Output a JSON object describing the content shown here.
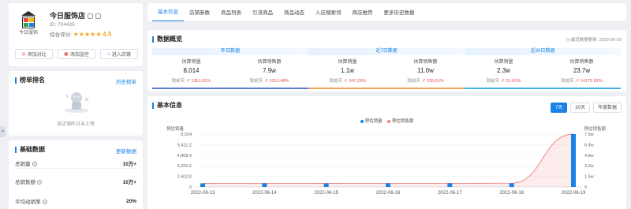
{
  "shop": {
    "name": "今日服饰店",
    "logo_text": "今日服饰",
    "id_label": "ID: 704425",
    "rating_label": "综合评分:",
    "stars": "★★★★★",
    "rating": "4.5"
  },
  "shop_buttons": [
    {
      "label": "添加对比",
      "icon": "target-icon"
    },
    {
      "label": "添加监控",
      "icon": "monitor-icon"
    },
    {
      "label": "进入店铺",
      "icon": "store-icon"
    }
  ],
  "ranking": {
    "title": "榜单排名",
    "link": "历史榜单",
    "empty_text": "该店铺昨日未上榜"
  },
  "base_data": {
    "title": "基础数据",
    "link": "更新数据",
    "rows": [
      {
        "label": "总销量",
        "value": "10万+"
      },
      {
        "label": "总销售额",
        "value": "10万+"
      },
      {
        "label": "平均动销率",
        "value": "20%"
      }
    ]
  },
  "tabs": [
    "基本信息",
    "店铺参数",
    "商品列表",
    "引流商品",
    "商品动态",
    "入店搜索词",
    "商店推荐",
    "更多历史数据"
  ],
  "overview": {
    "title": "数据概览",
    "update": "最近数据更新: 2022-06-20",
    "periods": [
      {
        "title": "昨日数据",
        "sales_label": "估算销量",
        "sales": "8,014",
        "sales_chg_label": "较前天",
        "sales_chg": "1351.81%",
        "amount_label": "估算销售额",
        "amount": "7.9w",
        "amount_chg_label": "较前天",
        "amount_chg": "1313.48%"
      },
      {
        "title": "近7日数据",
        "sales_label": "估算销量",
        "sales": "1.1w",
        "sales_chg_label": "较前天",
        "sales_chg": "247.29%",
        "amount_label": "估算销售额",
        "amount": "11.0w",
        "amount_chg_label": "较前天",
        "amount_chg": "239.61%"
      },
      {
        "title": "近30日数据",
        "sales_label": "估算销量",
        "sales": "2.3w",
        "sales_chg_label": "较前天",
        "sales_chg": "51.62%",
        "amount_label": "估算销售额",
        "amount": "23.7w",
        "amount_chg_label": "较前天",
        "amount_chg": "14175.82%"
      }
    ]
  },
  "basic_info": {
    "title": "基本信息",
    "ranges": [
      "7天",
      "30天",
      "年度数据"
    ],
    "active_range": "7天"
  },
  "chart_data": {
    "type": "bar",
    "categories": [
      "2022-06-13",
      "2022-06-14",
      "2022-06-15",
      "2022-06-16",
      "2022-06-17",
      "2022-06-18",
      "2022-06-19"
    ],
    "series": [
      {
        "name": "预估销量",
        "type": "bar",
        "axis": "left",
        "color": "#1a82e6",
        "values": [
          540,
          560,
          540,
          550,
          560,
          560,
          8014
        ]
      },
      {
        "name": "预估销售额",
        "type": "area",
        "axis": "right",
        "color": "#f08080",
        "values": [
          5300,
          5400,
          5300,
          5400,
          5400,
          5500,
          79000
        ]
      }
    ],
    "ylabel": "预估销量",
    "y2label": "预估销售额",
    "yticks": [
      "0",
      "1,602.8",
      "3,205.6",
      "4,808.4",
      "6,411.2",
      "8,014"
    ],
    "ylim": [
      0,
      8014
    ],
    "y2ticks": [
      "0",
      "1.6w",
      "3.2w",
      "4.8w",
      "6.4w",
      "7.9w"
    ],
    "y2lim": [
      0,
      79000
    ],
    "grid": true,
    "legend": "top-center"
  },
  "colors": {
    "accent": "#1a82e6",
    "up": "#e54b4b",
    "star": "#f5a623"
  }
}
